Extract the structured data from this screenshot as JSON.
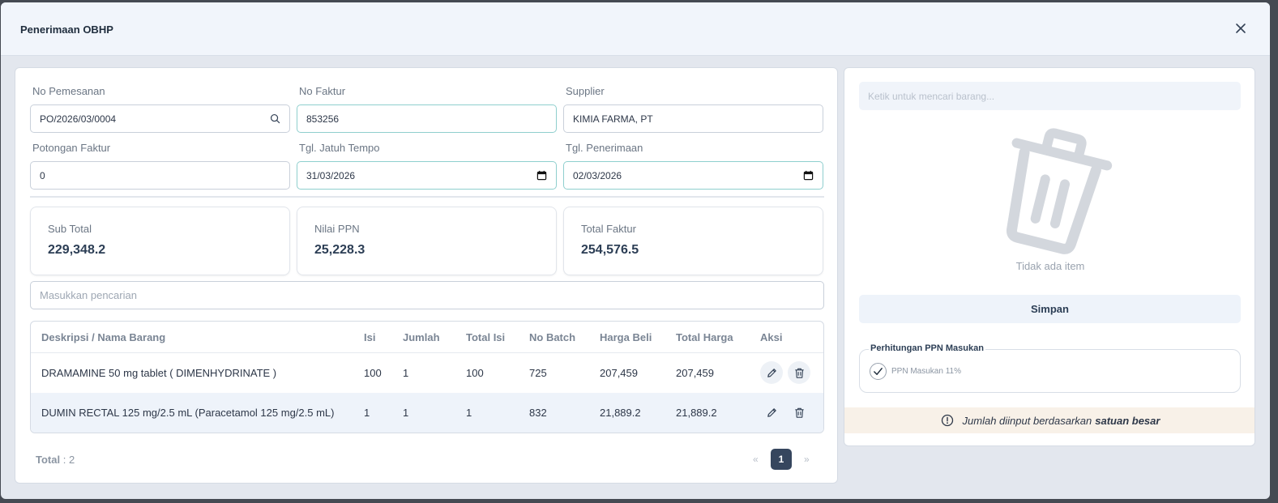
{
  "modal": {
    "title": "Penerimaan OBHP"
  },
  "form": {
    "no_pemesanan": {
      "label": "No Pemesanan",
      "value": "PO/2026/03/0004"
    },
    "no_faktur": {
      "label": "No Faktur",
      "value": "853256"
    },
    "supplier": {
      "label": "Supplier",
      "value": "KIMIA FARMA, PT"
    },
    "potongan_faktur": {
      "label": "Potongan Faktur",
      "value": "0"
    },
    "tgl_jatuh_tempo": {
      "label": "Tgl. Jatuh Tempo",
      "value": "31/03/2026"
    },
    "tgl_penerimaan": {
      "label": "Tgl. Penerimaan",
      "value": "02/03/2026"
    }
  },
  "summary": {
    "sub_total": {
      "label": "Sub Total",
      "value": "229,348.2"
    },
    "nilai_ppn": {
      "label": "Nilai PPN",
      "value": "25,228.3"
    },
    "total_faktur": {
      "label": "Total Faktur",
      "value": "254,576.5"
    }
  },
  "search": {
    "placeholder": "Masukkan pencarian"
  },
  "table": {
    "headers": [
      "Deskripsi / Nama Barang",
      "Isi",
      "Jumlah",
      "Total Isi",
      "No Batch",
      "Harga Beli",
      "Total Harga",
      "Aksi"
    ],
    "rows": [
      {
        "nama": "DRAMAMINE 50 mg tablet ( DIMENHYDRINATE )",
        "isi": "100",
        "jumlah": "1",
        "total_isi": "100",
        "no_batch": "725",
        "harga_beli": "207,459",
        "total_harga": "207,459"
      },
      {
        "nama": "DUMIN RECTAL 125 mg/2.5 mL (Paracetamol 125 mg/2.5 mL)",
        "isi": "1",
        "jumlah": "1",
        "total_isi": "1",
        "no_batch": "832",
        "harga_beli": "21,889.2",
        "total_harga": "21,889.2"
      }
    ]
  },
  "footer": {
    "total_label": "Total",
    "total_value": ": 2",
    "prev": "«",
    "page": "1",
    "next": "»"
  },
  "right_panel": {
    "item_search_placeholder": "Ketik untuk mencari barang...",
    "empty_text": "Tidak ada item",
    "save_label": "Simpan",
    "ppn_legend": "Perhitungan PPN Masukan",
    "ppn_checkbox_label": "PPN Masukan 11%",
    "ppn_checked": true,
    "notice_text": "Jumlah diinput berdasarkan",
    "notice_bold": "satuan besar"
  },
  "icons": [
    "close-icon",
    "search-icon",
    "calendar-icon",
    "edit-icon",
    "trash-icon",
    "check-icon",
    "info-icon"
  ]
}
